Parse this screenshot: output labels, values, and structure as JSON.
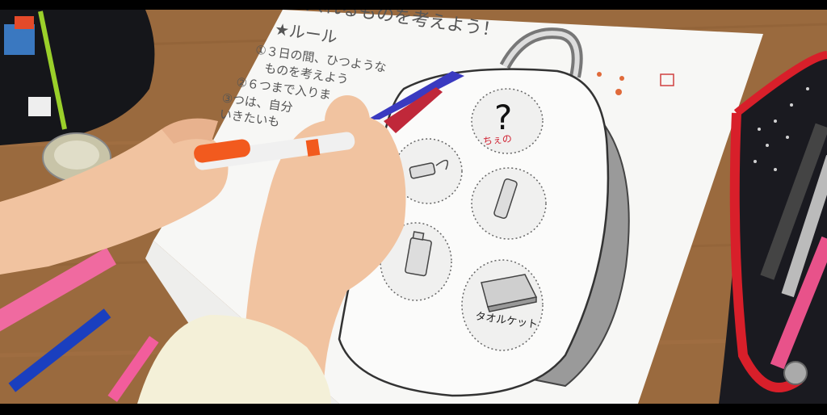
{
  "worksheet": {
    "heading": "入れるものを考えよう！",
    "rule_heading": "★ルール",
    "rule_1a": "①３日の間、ひつような",
    "rule_1b": "ものを考えよう",
    "rule_2": "②６つまで入りま",
    "rule_3a": "③つは、自分",
    "rule_3b": "いきたいも",
    "question_mark": "?",
    "handwritten_name": "ちぇの",
    "towel_label": "タオルケット"
  }
}
